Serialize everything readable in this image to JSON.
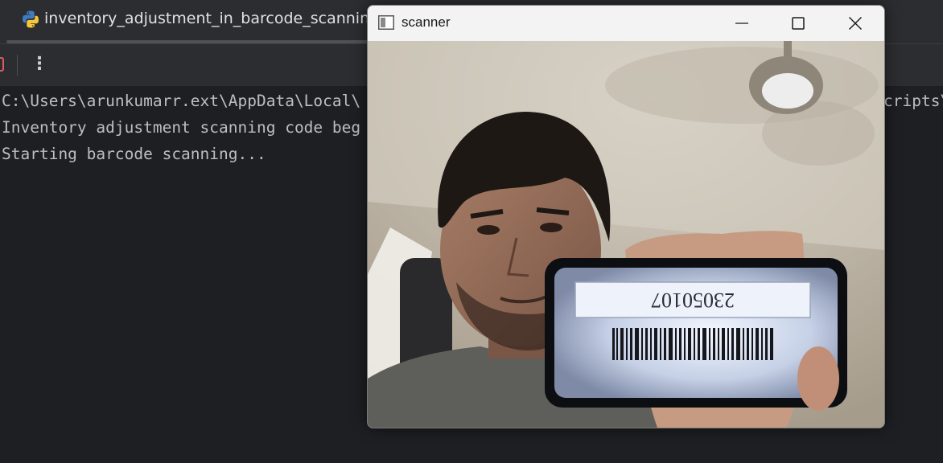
{
  "ide": {
    "tab": {
      "label": "inventory_adjustment_in_barcode_scanning",
      "icon": "python-icon"
    },
    "toolbar": {
      "stop_icon": "stop-icon",
      "more_icon": "more-vertical-icon",
      "more_glyph": "⋮"
    },
    "console": {
      "lines": [
        "C:\\Users\\arunkumarr.ext\\AppData\\Local\\",
        "Inventory adjustment scanning code beg",
        "Starting barcode scanning..."
      ],
      "line1_tail": "cripts\\"
    }
  },
  "scanner_window": {
    "title": "scanner",
    "app_icon": "window-app-icon",
    "buttons": {
      "minimize": "minimize-icon",
      "maximize": "maximize-icon",
      "close": "close-icon"
    },
    "camera_feed": {
      "barcode_number": "23050107"
    }
  },
  "colors": {
    "ide_background": "#1e1f22",
    "ide_panel": "#2b2d30",
    "console_text": "#bcbec4",
    "stop_red": "#db5c5c",
    "titlebar": "#f3f3f3"
  }
}
